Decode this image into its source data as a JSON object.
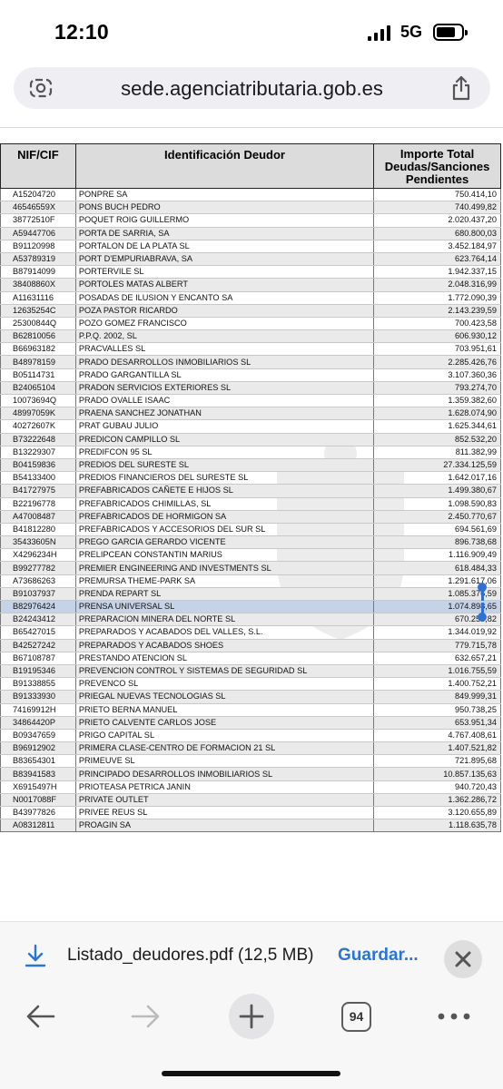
{
  "status_bar": {
    "time": "12:10",
    "network": "5G"
  },
  "address_bar": {
    "url": "sede.agenciatributaria.gob.es"
  },
  "table": {
    "headers": {
      "nif": "NIF/CIF",
      "name": "Identificación Deudor",
      "amount_line1": "Importe Total",
      "amount_line2": "Deudas/Sanciones",
      "amount_line3": "Pendientes"
    },
    "rows": [
      {
        "nif": "A15204720",
        "name": "PONPRE SA",
        "amount": "750.414,10"
      },
      {
        "nif": "46546559X",
        "name": "PONS BUCH PEDRO",
        "amount": "740.499,82"
      },
      {
        "nif": "38772510F",
        "name": "POQUET ROIG GUILLERMO",
        "amount": "2.020.437,20"
      },
      {
        "nif": "A59447706",
        "name": "PORTA DE SARRIA, SA",
        "amount": "680.800,03"
      },
      {
        "nif": "B91120998",
        "name": "PORTALON DE LA PLATA SL",
        "amount": "3.452.184,97"
      },
      {
        "nif": "A53789319",
        "name": "PORT D'EMPURIABRAVA, SA",
        "amount": "623.764,14"
      },
      {
        "nif": "B87914099",
        "name": "PORTERVILE SL",
        "amount": "1.942.337,15"
      },
      {
        "nif": "38408860X",
        "name": "PORTOLES MATAS ALBERT",
        "amount": "2.048.316,99"
      },
      {
        "nif": "A11631116",
        "name": "POSADAS DE ILUSION Y ENCANTO SA",
        "amount": "1.772.090,39"
      },
      {
        "nif": "12635254C",
        "name": "POZA PASTOR RICARDO",
        "amount": "2.143.239,59"
      },
      {
        "nif": "25300844Q",
        "name": "POZO GOMEZ FRANCISCO",
        "amount": "700.423,58"
      },
      {
        "nif": "B62810056",
        "name": "P.P.Q. 2002, SL",
        "amount": "606.930,12"
      },
      {
        "nif": "B66963182",
        "name": "PRACVALLES SL",
        "amount": "703.951,61"
      },
      {
        "nif": "B48978159",
        "name": "PRADO DESARROLLOS INMOBILIARIOS SL",
        "amount": "2.285.426,76"
      },
      {
        "nif": "B05114731",
        "name": "PRADO GARGANTILLA SL",
        "amount": "3.107.360,36"
      },
      {
        "nif": "B24065104",
        "name": "PRADON SERVICIOS EXTERIORES SL",
        "amount": "793.274,70"
      },
      {
        "nif": "10073694Q",
        "name": "PRADO OVALLE ISAAC",
        "amount": "1.359.382,60"
      },
      {
        "nif": "48997059K",
        "name": "PRAENA SANCHEZ JONATHAN",
        "amount": "1.628.074,90"
      },
      {
        "nif": "40272607K",
        "name": "PRAT GUBAU JULIO",
        "amount": "1.625.344,61"
      },
      {
        "nif": "B73222648",
        "name": "PREDICON CAMPILLO SL",
        "amount": "852.532,20"
      },
      {
        "nif": "B13229307",
        "name": "PREDIFCON 95 SL",
        "amount": "811.382,99"
      },
      {
        "nif": "B04159836",
        "name": "PREDIOS DEL SURESTE SL",
        "amount": "27.334.125,59"
      },
      {
        "nif": "B54133400",
        "name": "PREDIOS FINANCIEROS DEL SURESTE SL",
        "amount": "1.642.017,16"
      },
      {
        "nif": "B41727975",
        "name": "PREFABRICADOS CAÑETE E HIJOS SL",
        "amount": "1.499.380,67"
      },
      {
        "nif": "B22196778",
        "name": "PREFABRICADOS CHIMILLAS, SL",
        "amount": "1.098.590,83"
      },
      {
        "nif": "A47008487",
        "name": "PREFABRICADOS DE HORMIGON SA",
        "amount": "2.450.770,67"
      },
      {
        "nif": "B41812280",
        "name": "PREFABRICADOS Y ACCESORIOS DEL SUR SL",
        "amount": "694.561,69"
      },
      {
        "nif": "35433605N",
        "name": "PREGO GARCIA GERARDO VICENTE",
        "amount": "896.738,68"
      },
      {
        "nif": "X4296234H",
        "name": "PRELIPCEAN CONSTANTIN MARIUS",
        "amount": "1.116.909,49"
      },
      {
        "nif": "B99277782",
        "name": "PREMIER ENGINEERING AND INVESTMENTS SL",
        "amount": "618.484,33"
      },
      {
        "nif": "A73686263",
        "name": "PREMURSA THEME-PARK SA",
        "amount": "1.291.617,06"
      },
      {
        "nif": "B91037937",
        "name": "PRENDA REPART SL",
        "amount": "1.085.376,59"
      },
      {
        "nif": "B82976424",
        "name": "PRENSA UNIVERSAL SL",
        "amount": "1.074.898,65"
      },
      {
        "nif": "B24243412",
        "name": "PREPARACION MINERA DEL NORTE SL",
        "amount": "670.258,82"
      },
      {
        "nif": "B65427015",
        "name": "PREPARADOS Y ACABADOS DEL VALLES, S.L.",
        "amount": "1.344.019,92"
      },
      {
        "nif": "B42527242",
        "name": "PREPARADOS Y ACABADOS SHOES",
        "amount": "779.715,78"
      },
      {
        "nif": "B67108787",
        "name": "PRESTANDO ATENCION SL",
        "amount": "632.657,21"
      },
      {
        "nif": "B19195346",
        "name": "PREVENCION CONTROL Y SISTEMAS DE SEGURIDAD SL",
        "amount": "1.016.755,59"
      },
      {
        "nif": "B91338855",
        "name": "PREVENCO SL",
        "amount": "1.400.752,21"
      },
      {
        "nif": "B91333930",
        "name": "PRIEGAL NUEVAS TECNOLOGIAS SL",
        "amount": "849.999,31"
      },
      {
        "nif": "74169912H",
        "name": "PRIETO BERNA MANUEL",
        "amount": "950.738,25"
      },
      {
        "nif": "34864420P",
        "name": "PRIETO CALVENTE CARLOS JOSE",
        "amount": "653.951,34"
      },
      {
        "nif": "B09347659",
        "name": "PRIGO CAPITAL SL",
        "amount": "4.767.408,61"
      },
      {
        "nif": "B96912902",
        "name": "PRIMERA CLASE-CENTRO DE FORMACION 21 SL",
        "amount": "1.407.521,82"
      },
      {
        "nif": "B83654301",
        "name": "PRIMEUVE SL",
        "amount": "721.895,68"
      },
      {
        "nif": "B83941583",
        "name": "PRINCIPADO DESARROLLOS INMOBILIARIOS SL",
        "amount": "10.857.135,63"
      },
      {
        "nif": "X6915497H",
        "name": "PRIOTEASA PETRICA JANIN",
        "amount": "940.720,43"
      },
      {
        "nif": "N0017088F",
        "name": "PRIVATE OUTLET",
        "amount": "1.362.286,72"
      },
      {
        "nif": "B43977826",
        "name": "PRIVEE REUS SL",
        "amount": "3.120.655,89"
      },
      {
        "nif": "A08312811",
        "name": "PROAGIN SA",
        "amount": "1.118.635,78"
      }
    ]
  },
  "download_bar": {
    "filename": "Listado_deudores.pdf (12,5 MB)",
    "action": "Guardar..."
  },
  "toolbar": {
    "tab_count": "94"
  },
  "colors": {
    "accent": "#2a74d8",
    "header_bg": "#dcdcdc",
    "highlight_row": "#c6d3e6",
    "selection_handle": "#2f6fd6"
  },
  "icons": [
    "signal-icon",
    "battery-icon",
    "lens-icon",
    "share-icon",
    "download-icon",
    "close-icon",
    "back-arrow-icon",
    "forward-arrow-icon",
    "plus-icon",
    "tabs-icon",
    "more-icon"
  ]
}
